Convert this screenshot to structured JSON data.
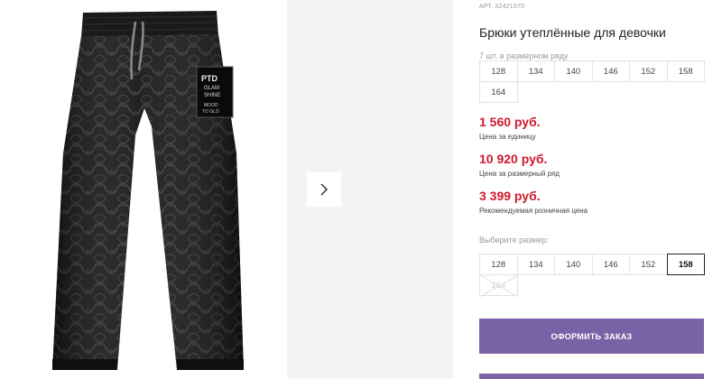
{
  "product": {
    "sku": "АРТ. 32421970",
    "title": "Брюки утеплённые для девочки",
    "pack_label": "7 шт. в размерном ряду",
    "pack_sizes": [
      "128",
      "134",
      "140",
      "146",
      "152",
      "158",
      "164"
    ],
    "photo_patch_lines": [
      "PTD",
      "GLAM",
      "SHINE",
      "MOOD",
      "TO GLO"
    ]
  },
  "prices": {
    "unit_price": "1 560 руб.",
    "unit_note": "Цена за единицу",
    "pack_price": "10 920 руб.",
    "pack_note": "Цена за размерный ряд",
    "retail_price": "3 399 руб.",
    "retail_note": "Рекомендуемая розничная цена",
    "price_color": "#d0192d"
  },
  "size_picker": {
    "label": "Выберите размер:",
    "sizes": [
      "128",
      "134",
      "140",
      "146",
      "152",
      "158",
      "164"
    ],
    "selected": "158",
    "disabled": [
      "164"
    ]
  },
  "actions": {
    "order_label": "ОФОРМИТЬ ЗАКАЗ",
    "accent_color": "#7a62a7"
  },
  "icons": {
    "next": "chevron-right-icon"
  }
}
